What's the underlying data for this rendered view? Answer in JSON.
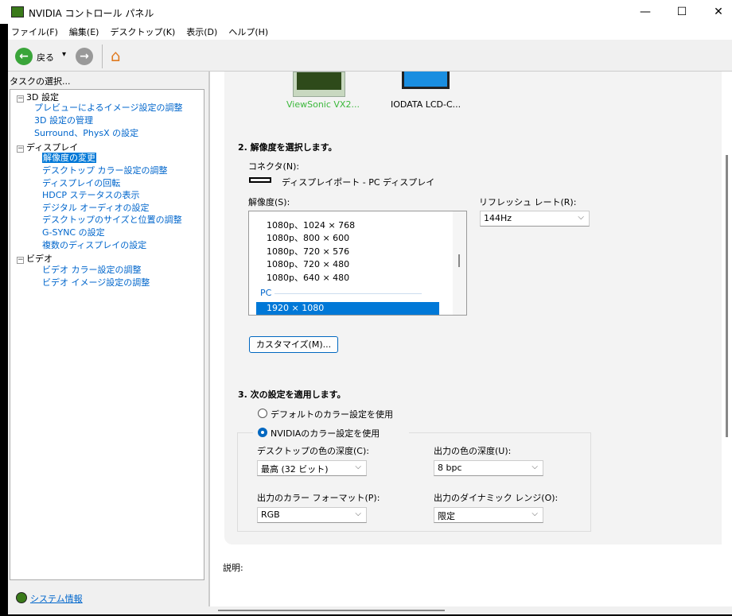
{
  "window": {
    "title": "NVIDIA コントロール パネル",
    "minimize": "—",
    "maximize": "☐",
    "close": "✕"
  },
  "menu": [
    "ファイル(F)",
    "編集(E)",
    "デスクトップ(K)",
    "表示(D)",
    "ヘルプ(H)"
  ],
  "toolbar": {
    "back_label": "戻る",
    "dropdown": "▾"
  },
  "left": {
    "heading": "タスクの選択...",
    "tree": [
      {
        "label": "3D 設定",
        "children": [
          "プレビューによるイメージ設定の調整",
          "3D 設定の管理",
          "Surround、PhysX の設定"
        ]
      },
      {
        "label": "ディスプレイ",
        "children": [
          "解像度の変更",
          "デスクトップ カラー設定の調整",
          "ディスプレイの回転",
          "HDCP ステータスの表示",
          "デジタル オーディオの設定",
          "デスクトップのサイズと位置の調整",
          "G-SYNC の設定",
          "複数のディスプレイの設定"
        ]
      },
      {
        "label": "ビデオ",
        "children": [
          "ビデオ カラー設定の調整",
          "ビデオ イメージ設定の調整"
        ]
      }
    ],
    "selected": "解像度の変更",
    "system_info": "システム情報"
  },
  "displays": [
    {
      "name": "ViewSonic VX2...",
      "selected": true
    },
    {
      "name": "IODATA LCD-C...",
      "selected": false
    }
  ],
  "section2": {
    "heading": "2. 解像度を選択します。",
    "connector_label": "コネクタ(N):",
    "connector_value": "ディスプレイポート - PC ディスプレイ",
    "resolution_label": "解像度(S):",
    "resolutions": [
      "1080p、1024 × 768",
      "1080p、800 × 600",
      "1080p、720 × 576",
      "1080p、720 × 480",
      "1080p、640 × 480"
    ],
    "group_pc": "PC",
    "selected_resolution": "1920 × 1080",
    "refresh_label": "リフレッシュ レート(R):",
    "refresh_value": "144Hz",
    "customize": "カスタマイズ(M)..."
  },
  "section3": {
    "heading": "3. 次の設定を適用します。",
    "radio_default": "デフォルトのカラー設定を使用",
    "radio_nvidia": "NVIDIAのカラー設定を使用",
    "desktop_depth_label": "デスクトップの色の深度(C):",
    "desktop_depth_value": "最高 (32 ビット)",
    "output_depth_label": "出力の色の深度(U):",
    "output_depth_value": "8 bpc",
    "color_format_label": "出力のカラー フォーマット(P):",
    "color_format_value": "RGB",
    "dynamic_range_label": "出力のダイナミック レンジ(O):",
    "dynamic_range_value": "限定"
  },
  "description_label": "説明:"
}
